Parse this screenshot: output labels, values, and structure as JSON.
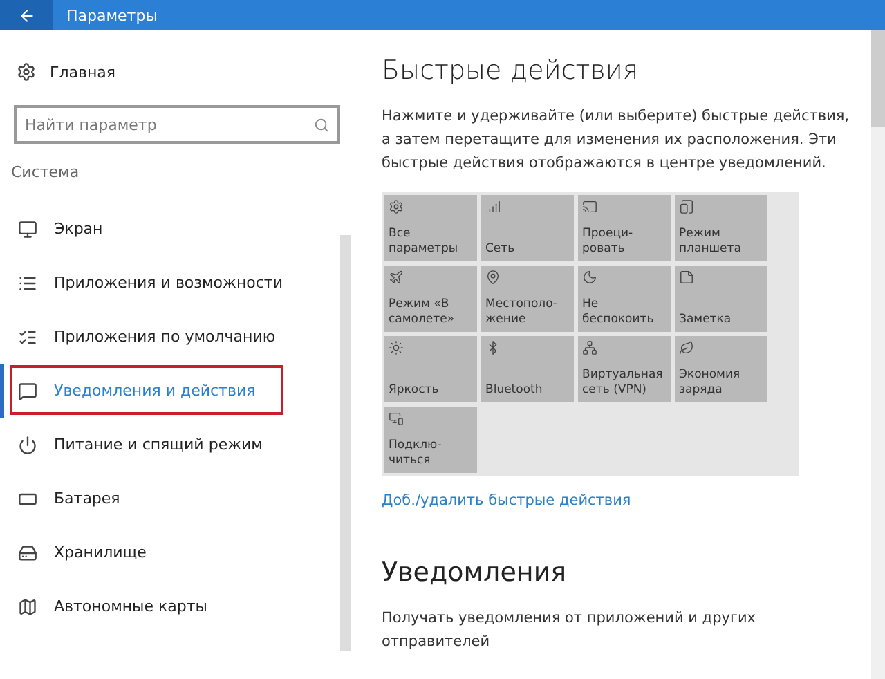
{
  "window": {
    "title": "Параметры"
  },
  "sidebar": {
    "home": "Главная",
    "search": {
      "placeholder": "Найти параметр"
    },
    "section": "Система",
    "items": [
      {
        "label": "Экран",
        "selected": false
      },
      {
        "label": "Приложения и возможности",
        "selected": false
      },
      {
        "label": "Приложения по умолчанию",
        "selected": false
      },
      {
        "label": "Уведомления и действия",
        "selected": true
      },
      {
        "label": "Питание и спящий режим",
        "selected": false
      },
      {
        "label": "Батарея",
        "selected": false
      },
      {
        "label": "Хранилище",
        "selected": false
      },
      {
        "label": "Автономные карты",
        "selected": false
      }
    ]
  },
  "main": {
    "title": "Быстрые действия",
    "description": "Нажмите и удерживайте (или выберите) быстрые действия, а затем перетащите для изменения их расположения. Эти быстрые действия отображаются в центре уведомлений.",
    "tiles": [
      {
        "label": "Все параметры"
      },
      {
        "label": "Сеть"
      },
      {
        "label": "Проеци-\nровать"
      },
      {
        "label": "Режим планшета"
      },
      {
        "label": "Режим «В самолете»"
      },
      {
        "label": "Местополо-\nжение"
      },
      {
        "label": "Не беспокоить"
      },
      {
        "label": "Заметка"
      },
      {
        "label": "Яркость"
      },
      {
        "label": "Bluetooth"
      },
      {
        "label": "Виртуальная сеть (VPN)"
      },
      {
        "label": "Экономия заряда"
      },
      {
        "label": "Подклю-\nчиться"
      }
    ],
    "link": "Доб./удалить быстрые действия",
    "notifications": {
      "title": "Уведомления",
      "description": "Получать уведомления от приложений и других отправителей"
    }
  }
}
